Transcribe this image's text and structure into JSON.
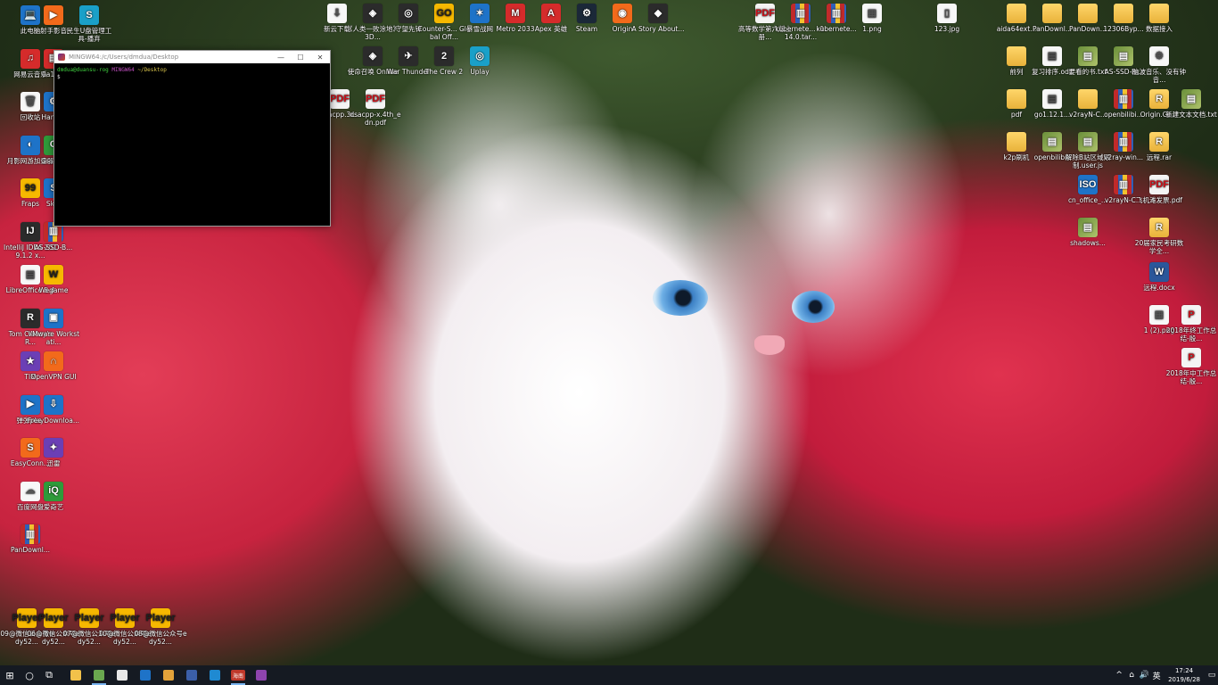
{
  "desktop": {
    "icons_left": [
      {
        "label": "此电脑",
        "glyph": "💻",
        "style": "g-blue"
      },
      {
        "label": "网易云音乐",
        "glyph": "♫",
        "style": "g-red"
      },
      {
        "label": "回收站",
        "glyph": "🗑",
        "style": "g-file"
      },
      {
        "label": "月影网游加速器",
        "glyph": "◐",
        "style": "g-blue"
      },
      {
        "label": "Fraps",
        "glyph": "99",
        "style": "g-yellow"
      },
      {
        "label": "IntelliJ IDEA 2019.1.2 x...",
        "glyph": "IJ",
        "style": "g-exe"
      },
      {
        "label": "LibreOffice 5.4",
        "glyph": "▤",
        "style": "g-file"
      },
      {
        "label": "Tom Clancy's R...",
        "glyph": "R",
        "style": "g-exe"
      },
      {
        "label": "TIM",
        "glyph": "★",
        "style": "g-purple"
      },
      {
        "label": "弹弹play",
        "glyph": "▶",
        "style": "g-blue"
      },
      {
        "label": "EasyConn...",
        "glyph": "S",
        "style": "g-orange"
      },
      {
        "label": "百度网盘",
        "glyph": "☁",
        "style": "g-file"
      },
      {
        "label": "PanDownl...",
        "glyph": "▥",
        "style": "g-zip"
      }
    ],
    "icons_left2": [
      {
        "label": "射手影音",
        "glyph": "▶",
        "style": "g-orange"
      },
      {
        "label": "0a18...",
        "glyph": "▤",
        "style": "g-red"
      },
      {
        "label": "Hand...",
        "glyph": "⚙",
        "style": "g-blue"
      },
      {
        "label": "Gram...",
        "glyph": "G",
        "style": "g-green"
      },
      {
        "label": "Sk...",
        "glyph": "S",
        "style": "g-blue"
      },
      {
        "label": "AS-SSD-B...",
        "glyph": "▥",
        "style": "g-zip"
      },
      {
        "label": "Wegame",
        "glyph": "W",
        "style": "g-yellow"
      },
      {
        "label": "VMware Workstati...",
        "glyph": "▣",
        "style": "g-blue"
      },
      {
        "label": "OpenVPN GUI",
        "glyph": "∩",
        "style": "g-orange"
      },
      {
        "label": "Free Downloa...",
        "glyph": "⇩",
        "style": "g-blue"
      },
      {
        "label": "迅雷",
        "glyph": "✦",
        "style": "g-purple"
      },
      {
        "label": "爱奇艺",
        "glyph": "iQ",
        "style": "g-green"
      }
    ],
    "icons_col3": [
      {
        "label": "民生U盘管理工具-播弃",
        "glyph": "S",
        "style": "g-teal"
      }
    ],
    "icons_top": [
      {
        "label": "新云下载",
        "glyph": "⇩",
        "style": "g-file"
      },
      {
        "label": "《人类一败涂地》3D...",
        "glyph": "◈",
        "style": "g-exe"
      },
      {
        "label": "守望先锋",
        "glyph": "◎",
        "style": "g-exe"
      },
      {
        "label": "Counter-S... Global Off...",
        "glyph": "GO",
        "style": "g-yellow"
      },
      {
        "label": "暴雪战网",
        "glyph": "✶",
        "style": "g-blue"
      },
      {
        "label": "Metro 2033",
        "glyph": "M",
        "style": "g-red"
      },
      {
        "label": "Apex 英雄",
        "glyph": "A",
        "style": "g-red"
      },
      {
        "label": "Steam",
        "glyph": "⚙",
        "style": "g-steam"
      },
      {
        "label": "Origin",
        "glyph": "◉",
        "style": "g-orange"
      },
      {
        "label": "A Story About...",
        "glyph": "◆",
        "style": "g-exe"
      }
    ],
    "icons_top2": [
      {
        "label": "使命召唤 Online",
        "glyph": "◈",
        "style": "g-exe"
      },
      {
        "label": "War Thunder",
        "glyph": "✈",
        "style": "g-exe"
      },
      {
        "label": "The Crew 2",
        "glyph": "2",
        "style": "g-exe"
      },
      {
        "label": "Uplay",
        "glyph": "◎",
        "style": "g-teal"
      }
    ],
    "icons_pdf": [
      {
        "label": "dsacpp.3r...",
        "glyph": "PDF",
        "style": "g-pdf"
      },
      {
        "label": "dsacpp-x.4th_edn.pdf",
        "glyph": "PDF",
        "style": "g-pdf"
      }
    ],
    "icons_top_right": [
      {
        "label": "高等数学第六版上册...",
        "glyph": "PDF",
        "style": "g-pdf"
      },
      {
        "label": "kubernete... -1.14.0.tar...",
        "glyph": "▥",
        "style": "g-zip"
      },
      {
        "label": "kubernete...",
        "glyph": "▥",
        "style": "g-zip"
      },
      {
        "label": "1.png",
        "glyph": "▦",
        "style": "g-file"
      },
      {
        "label": "123.jpg",
        "glyph": "▯",
        "style": "g-file"
      }
    ],
    "icons_right_row1": [
      {
        "label": "aida64ext...",
        "glyph": "",
        "style": "g-folder"
      },
      {
        "label": "PanDownl...",
        "glyph": "",
        "style": "g-folder"
      },
      {
        "label": "PanDown...",
        "glyph": "",
        "style": "g-folder"
      },
      {
        "label": "12306Byp...",
        "glyph": "",
        "style": "g-folder"
      },
      {
        "label": "数据接入",
        "glyph": "",
        "style": "g-folder"
      }
    ],
    "icons_right_row2": [
      {
        "label": "前列",
        "glyph": "",
        "style": "g-folder"
      },
      {
        "label": "复习排序.ods",
        "glyph": "▤",
        "style": "g-file"
      },
      {
        "label": "要看的书.txt",
        "glyph": "▤",
        "style": "g-img"
      },
      {
        "label": "AS-SSD-B...",
        "glyph": "▤",
        "style": "g-img"
      },
      {
        "label": "脑波音乐、没有钟音...",
        "glyph": "⚙",
        "style": "g-file"
      }
    ],
    "icons_right_row3": [
      {
        "label": "pdf",
        "glyph": "",
        "style": "g-folder"
      },
      {
        "label": "go1.12.1...",
        "glyph": "▤",
        "style": "g-file"
      },
      {
        "label": "v2rayN-C...",
        "glyph": "",
        "style": "g-folder"
      },
      {
        "label": "openbilibi...",
        "glyph": "▥",
        "style": "g-zip"
      },
      {
        "label": "Origin.Ga...",
        "glyph": "R",
        "style": "g-folder"
      },
      {
        "label": "新建文本文档.txt",
        "glyph": "▤",
        "style": "g-img"
      }
    ],
    "icons_right_row4": [
      {
        "label": "k2p刷机",
        "glyph": "",
        "style": "g-folder"
      },
      {
        "label": "openbilibili",
        "glyph": "▤",
        "style": "g-img"
      },
      {
        "label": "解除B站区域限制.user.js",
        "glyph": "▤",
        "style": "g-img"
      },
      {
        "label": "v2ray-win...",
        "glyph": "▥",
        "style": "g-zip"
      },
      {
        "label": "远程.rar",
        "glyph": "R",
        "style": "g-folder"
      }
    ],
    "icons_right_row5": [
      {
        "label": "cn_office_...",
        "glyph": "ISO",
        "style": "g-blue"
      },
      {
        "label": "v2rayN-C...",
        "glyph": "▥",
        "style": "g-zip"
      },
      {
        "label": "飞机滩发票.pdf",
        "glyph": "PDF",
        "style": "g-pdf"
      }
    ],
    "icons_right_row6": [
      {
        "label": "shadows...",
        "glyph": "▤",
        "style": "g-img"
      },
      {
        "label": "20届家民考研数学全...",
        "glyph": "R",
        "style": "g-folder"
      }
    ],
    "icons_right_col": [
      {
        "label": "远程.docx",
        "glyph": "W",
        "style": "g-word"
      },
      {
        "label": "1 (2).png",
        "glyph": "▦",
        "style": "g-file"
      },
      {
        "label": "2018年终工作总结-殷...",
        "glyph": "P",
        "style": "g-pdf"
      },
      {
        "label": "2018年中工作总结-殷...",
        "glyph": "P",
        "style": "g-pdf"
      }
    ],
    "icons_bottom": [
      {
        "label": "09@微信公众号edy52...",
        "glyph": "Player",
        "style": "g-yellow"
      },
      {
        "label": "06@微信公众号edy52...",
        "glyph": "Player",
        "style": "g-yellow"
      },
      {
        "label": "07@微信公众号edy52...",
        "glyph": "Player",
        "style": "g-yellow"
      },
      {
        "label": "10@微信公众号edy52...",
        "glyph": "Player",
        "style": "g-yellow"
      },
      {
        "label": "08@微信公众号edy52...",
        "glyph": "Player",
        "style": "g-yellow"
      }
    ]
  },
  "terminal": {
    "title": "MINGW64:/c/Users/dmdua/Desktop",
    "user_host": "dmdua@duansu-rog",
    "shell": "MINGW64",
    "path": "~/Desktop",
    "prompt": "$",
    "minimize": "—",
    "maximize": "☐",
    "close": "✕"
  },
  "taskbar": {
    "start_glyph": "⊞",
    "search_glyph": "○",
    "taskview_glyph": "⧉",
    "apps": [
      {
        "name": "file-explorer",
        "color": "#f2c14a",
        "active": false
      },
      {
        "name": "app-2",
        "color": "#6aa84f",
        "active": true
      },
      {
        "name": "app-3",
        "color": "#e8e8e8",
        "active": false
      },
      {
        "name": "edge",
        "color": "#1e73c8",
        "active": false
      },
      {
        "name": "chrome",
        "color": "#e2a23a",
        "active": false
      },
      {
        "name": "app-6",
        "color": "#3b5fa8",
        "active": false
      },
      {
        "name": "vscode",
        "color": "#1f8ad2",
        "active": false
      },
      {
        "name": "app-8",
        "color": "#c0392b",
        "active": true
      },
      {
        "name": "app-9",
        "color": "#8e44ad",
        "active": false
      }
    ],
    "app8_label": "海南",
    "tray": {
      "chevron": "^",
      "network": "⌂",
      "volume": "🔊",
      "ime": "英",
      "time": "17:24",
      "date": "2019/6/28",
      "notification": "▭"
    }
  }
}
